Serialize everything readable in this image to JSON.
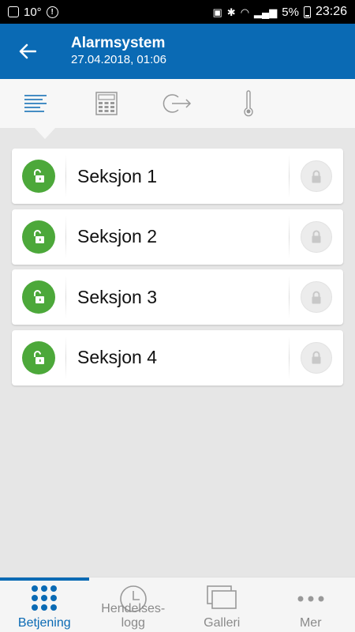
{
  "status_bar": {
    "temperature": "10°",
    "battery_percent": "5%",
    "time": "23:26"
  },
  "app_bar": {
    "title": "Alarmsystem",
    "subtitle": "27.04.2018, 01:06",
    "back_icon": "arrow-left-icon"
  },
  "tabs": [
    {
      "icon": "list-icon",
      "active": true
    },
    {
      "icon": "keypad-icon",
      "active": false
    },
    {
      "icon": "exit-icon",
      "active": false
    },
    {
      "icon": "thermometer-icon",
      "active": false
    }
  ],
  "sections": [
    {
      "label": "Seksjon 1",
      "state": "unlocked"
    },
    {
      "label": "Seksjon 2",
      "state": "unlocked"
    },
    {
      "label": "Seksjon 3",
      "state": "unlocked"
    },
    {
      "label": "Seksjon 4",
      "state": "unlocked"
    }
  ],
  "bottom_nav": [
    {
      "label": "Betjening",
      "icon": "grid-dots-icon",
      "active": true
    },
    {
      "label": "Hendelses-\nlogg",
      "icon": "clock-icon",
      "active": false
    },
    {
      "label": "Galleri",
      "icon": "gallery-icon",
      "active": false
    },
    {
      "label": "Mer",
      "icon": "more-dots-icon",
      "active": false
    }
  ],
  "colors": {
    "primary": "#0a6ab4",
    "unlocked_green": "#4ca83a",
    "locked_grey": "#ececec",
    "background": "#e6e6e6"
  }
}
